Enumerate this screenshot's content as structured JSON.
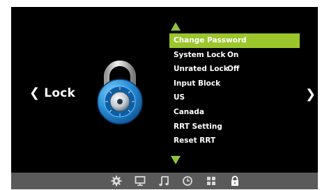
{
  "page": {
    "title": "Lock"
  },
  "nav": {
    "left_arrow": "❮",
    "right_arrow": "❯"
  },
  "menu": {
    "items": [
      {
        "label": "Change Password",
        "value": "",
        "selected": true
      },
      {
        "label": "System Lock",
        "value": "On",
        "selected": false
      },
      {
        "label": "Unrated Lock",
        "value": "Off",
        "selected": false
      },
      {
        "label": "Input Block",
        "value": "",
        "selected": false
      },
      {
        "label": "US",
        "value": "",
        "selected": false
      },
      {
        "label": "Canada",
        "value": "",
        "selected": false
      },
      {
        "label": "RRT Setting",
        "value": "",
        "selected": false
      },
      {
        "label": "Reset RRT",
        "value": "",
        "selected": false
      }
    ]
  },
  "bottom_bar": {
    "icons": [
      "gear-icon",
      "monitor-icon",
      "music-note-icon",
      "clock-icon",
      "grid-icon",
      "lock-icon"
    ],
    "active": "lock-icon"
  },
  "colors": {
    "highlight": "#9bc62c",
    "arrow": "#8fc43a",
    "background": "#000000",
    "bar": "#5a5a5a",
    "text": "#ffffff"
  }
}
